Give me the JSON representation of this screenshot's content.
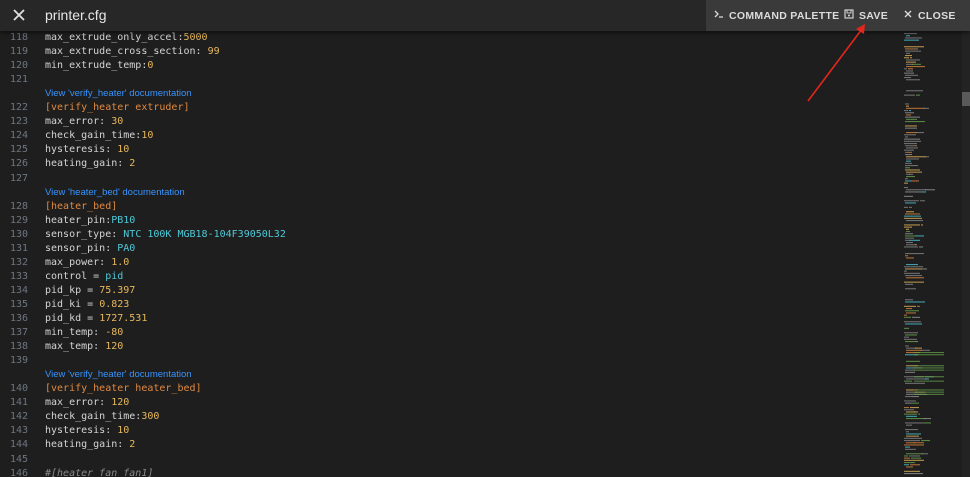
{
  "header": {
    "title": "printer.cfg",
    "close_icon": "close-icon",
    "actions": [
      {
        "label": "COMMAND PALETTE",
        "icon": "terminal-icon"
      },
      {
        "label": "SAVE",
        "icon": "floppy-disk-icon"
      },
      {
        "label": "CLOSE",
        "icon": "close-icon"
      }
    ]
  },
  "editor": {
    "lines": [
      {
        "n": "118",
        "key": "max_extrude_only_accel:",
        "val": "5000",
        "type": "num"
      },
      {
        "n": "119",
        "key": "max_extrude_cross_section: ",
        "val": "99",
        "type": "num"
      },
      {
        "n": "120",
        "key": "min_extrude_temp:",
        "val": "0",
        "type": "num"
      },
      {
        "n": "121",
        "key": "",
        "val": "",
        "type": "blank"
      },
      {
        "doc": "View 'verify_heater' documentation"
      },
      {
        "n": "122",
        "key": "",
        "val": "[verify_heater extruder]",
        "type": "section"
      },
      {
        "n": "123",
        "key": "max_error: ",
        "val": "30",
        "type": "num"
      },
      {
        "n": "124",
        "key": "check_gain_time:",
        "val": "10",
        "type": "num"
      },
      {
        "n": "125",
        "key": "hysteresis: ",
        "val": "10",
        "type": "num"
      },
      {
        "n": "126",
        "key": "heating_gain: ",
        "val": "2",
        "type": "num"
      },
      {
        "n": "127",
        "key": "",
        "val": "",
        "type": "blank"
      },
      {
        "doc": "View 'heater_bed' documentation"
      },
      {
        "n": "128",
        "key": "",
        "val": "[heater_bed]",
        "type": "section"
      },
      {
        "n": "129",
        "key": "heater_pin:",
        "val": "PB10",
        "type": "cyan"
      },
      {
        "n": "130",
        "key": "sensor_type: ",
        "val": "NTC 100K MGB18-104F39050L32",
        "type": "cyan"
      },
      {
        "n": "131",
        "key": "sensor_pin: ",
        "val": "PA0",
        "type": "cyan"
      },
      {
        "n": "132",
        "key": "max_power: ",
        "val": "1.0",
        "type": "num"
      },
      {
        "n": "133",
        "key": "control = ",
        "val": "pid",
        "type": "cyan"
      },
      {
        "n": "134",
        "key": "pid_kp = ",
        "val": "75.397",
        "type": "num"
      },
      {
        "n": "135",
        "key": "pid_ki = ",
        "val": "0.823",
        "type": "num"
      },
      {
        "n": "136",
        "key": "pid_kd = ",
        "val": "1727.531",
        "type": "num"
      },
      {
        "n": "137",
        "key": "min_temp: ",
        "val": "-80",
        "type": "num"
      },
      {
        "n": "138",
        "key": "max_temp: ",
        "val": "120",
        "type": "num"
      },
      {
        "n": "139",
        "key": "",
        "val": "",
        "type": "blank"
      },
      {
        "doc": "View 'verify_heater' documentation"
      },
      {
        "n": "140",
        "key": "",
        "val": "[verify_heater heater_bed]",
        "type": "section"
      },
      {
        "n": "141",
        "key": "max_error: ",
        "val": "120",
        "type": "num"
      },
      {
        "n": "142",
        "key": "check_gain_time:",
        "val": "300",
        "type": "num"
      },
      {
        "n": "143",
        "key": "hysteresis: ",
        "val": "10",
        "type": "num"
      },
      {
        "n": "144",
        "key": "heating_gain: ",
        "val": "2",
        "type": "num"
      },
      {
        "n": "145",
        "key": "",
        "val": "",
        "type": "blank"
      },
      {
        "n": "146",
        "key": "",
        "val": "#[heater_fan fan1]",
        "type": "comment"
      }
    ]
  },
  "colors": {
    "background": "#1e1e1e",
    "link": "#3794ff",
    "number": "#e8b85c",
    "identifier": "#4ec9d8",
    "section": "#e0893f",
    "annotation_arrow": "#e5271b"
  }
}
